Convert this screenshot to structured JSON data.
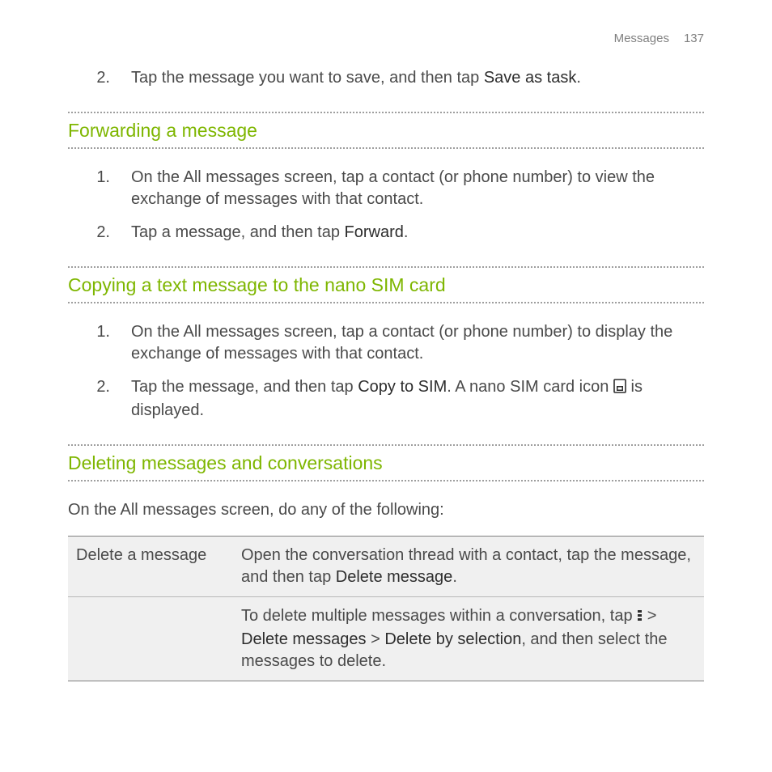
{
  "header": {
    "section": "Messages",
    "page": "137"
  },
  "intro_step": {
    "num": "2.",
    "pre": "Tap the message you want to save, and then tap ",
    "bold": "Save as task",
    "post": "."
  },
  "sec1": {
    "title": "Forwarding a message",
    "steps": [
      {
        "num": "1.",
        "text": "On the All messages screen, tap a contact (or phone number) to view the exchange of messages with that contact."
      },
      {
        "num": "2.",
        "pre": "Tap a message, and then tap ",
        "bold": "Forward",
        "post": "."
      }
    ]
  },
  "sec2": {
    "title": "Copying a text message to the nano SIM card",
    "steps": [
      {
        "num": "1.",
        "text": "On the All messages screen, tap a contact (or phone number) to display the exchange of messages with that contact."
      },
      {
        "num": "2.",
        "pre": "Tap the message, and then tap ",
        "bold": "Copy to SIM",
        "mid": ". A nano SIM card icon ",
        "post": " is displayed."
      }
    ]
  },
  "sec3": {
    "title": "Deleting messages and conversations",
    "lead": "On the All messages screen, do any of the following:",
    "row1_left": "Delete a message",
    "row1_pre": "Open the conversation thread with a contact, tap the message, and then tap ",
    "row1_bold": "Delete message",
    "row1_post": ".",
    "row2_pre": "To delete multiple messages within a conversation, tap ",
    "row2_b1": "Delete messages",
    "row2_mid": " > ",
    "row2_b2": "Delete by selection",
    "row2_post": ", and then select the messages to delete.",
    "gt": " > "
  }
}
